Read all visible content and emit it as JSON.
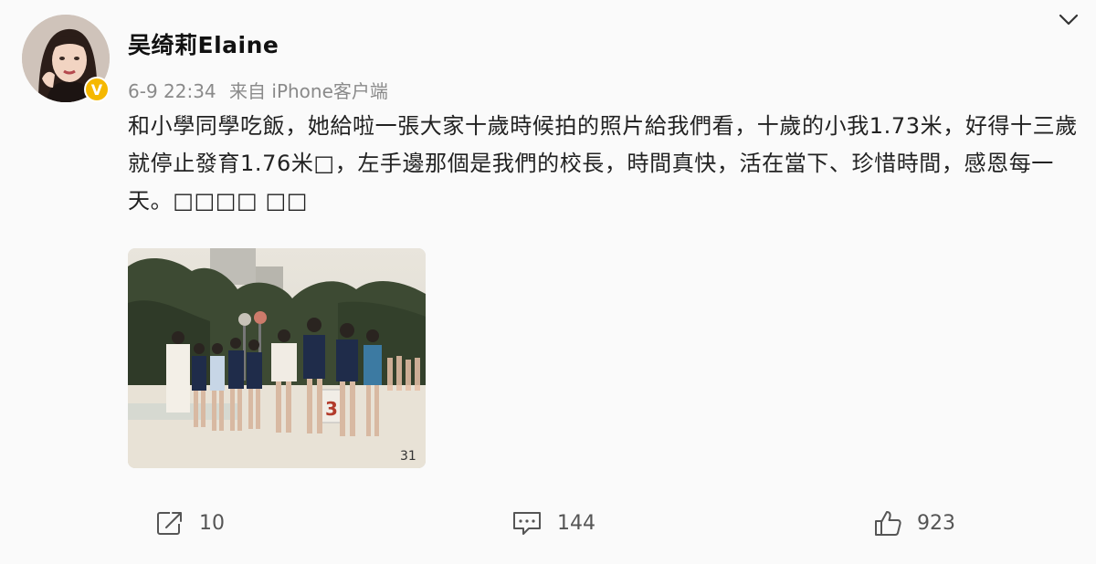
{
  "user": {
    "name": "吴绮莉Elaine",
    "verified_badge": "V",
    "badge_color": "#f5b800"
  },
  "post": {
    "time": "6-9 22:34",
    "source": "来自 iPhone客户端",
    "text": "和小學同學吃飯，她給啦一張大家十歲時候拍的照片給我們看，十歲的小我1.73米，好得十三歲就停止發育1.76米□，左手邊那個是我們的校長，時間真快，活在當下、珍惜時間，感恩每一天。□□□□ □□",
    "photo_caption_marks": [
      "3",
      "31"
    ]
  },
  "actions": {
    "repost_count": "10",
    "comment_count": "144",
    "like_count": "923"
  },
  "icons": {
    "menu": "chevron-down-icon",
    "repost": "share-icon",
    "comment": "comment-icon",
    "like": "thumbs-up-icon"
  }
}
